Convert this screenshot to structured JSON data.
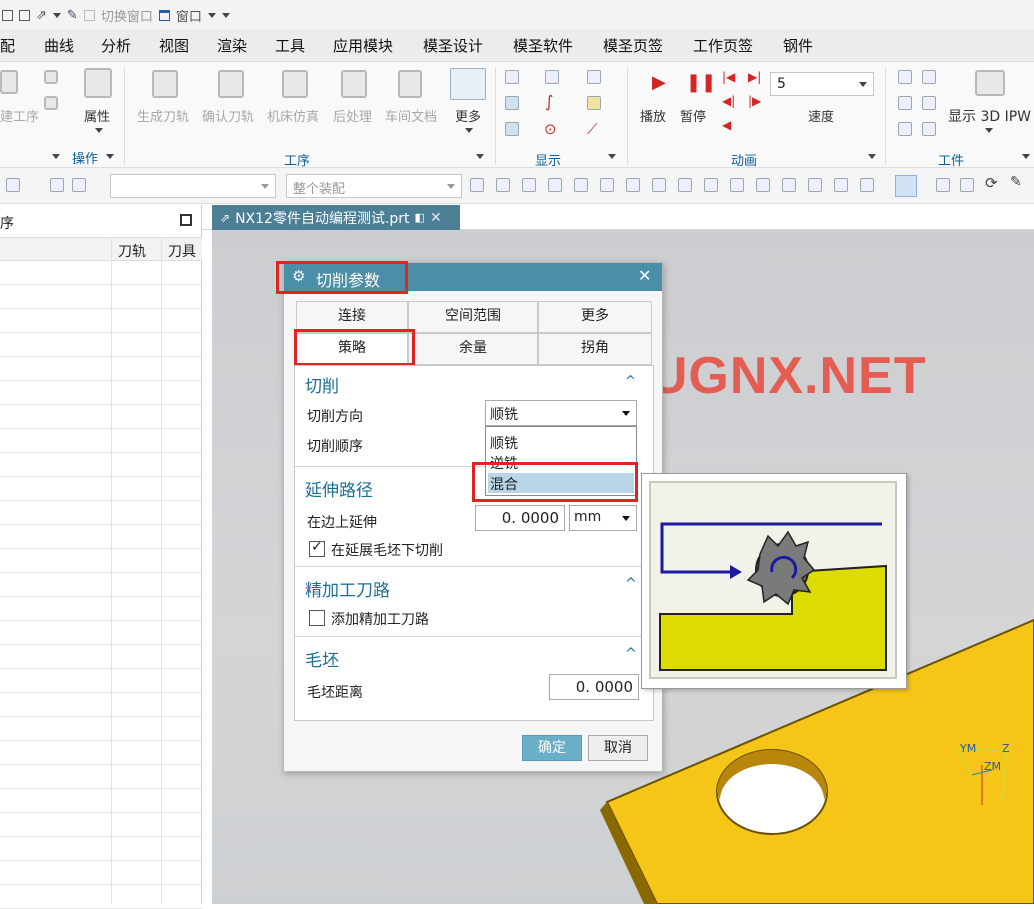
{
  "quick_access": {
    "switch_window": "切换窗口",
    "window": "窗口"
  },
  "menus": [
    "配",
    "曲线",
    "分析",
    "视图",
    "渲染",
    "工具",
    "应用模块",
    "模圣设计",
    "模圣软件",
    "模圣页签",
    "工作页签",
    "钢件"
  ],
  "ribbon": {
    "new_process": "建工序",
    "properties": "属性",
    "operations_group": "操作",
    "generate_path": "生成刀轨",
    "confirm_path": "确认刀轨",
    "machine_sim": "机床仿真",
    "postprocess": "后处理",
    "shop_doc": "车间文档",
    "more": "更多",
    "process_group": "工序",
    "display_group": "显示",
    "play": "播放",
    "pause": "暂停",
    "speed_value": "5",
    "speed": "速度",
    "animation_group": "动画",
    "show_3d_ipw": "显示 3D IPW",
    "workpiece_group": "工件"
  },
  "toolbar2": {
    "filter_value": "",
    "assembly_scope": "整个装配"
  },
  "navigator": {
    "title": "序",
    "col_path": "刀轨",
    "col_tool": "刀具"
  },
  "document_tab": "NX12零件自动编程测试.prt",
  "watermark": "WWW.UGNX.NET",
  "dialog": {
    "title": "切削参数",
    "tabs_row1": [
      "连接",
      "空间范围",
      "更多"
    ],
    "tabs_row2": [
      "策略",
      "余量",
      "拐角"
    ],
    "cut": {
      "header": "切削",
      "direction_label": "切削方向",
      "direction_value": "顺铣",
      "order_label": "切削顺序",
      "options": [
        "顺铣",
        "逆铣",
        "混合"
      ]
    },
    "extend": {
      "header": "延伸路径",
      "edge_label": "在边上延伸",
      "edge_value": "0. 0000",
      "unit": "mm",
      "cut_under_blank": "在延展毛坯下切削"
    },
    "finish": {
      "header": "精加工刀路",
      "add_finish": "添加精加工刀路"
    },
    "blank": {
      "header": "毛坯",
      "distance_label": "毛坯距离",
      "distance_value": "0. 0000"
    },
    "ok": "确定",
    "cancel": "取消"
  },
  "triad": {
    "ym": "YM",
    "zm": "ZM",
    "z": "Z"
  },
  "colors": {
    "accent": "#4b8ea8",
    "highlight": "#e32222",
    "part": "#f5c518",
    "preview_block": "#dcdc00"
  }
}
